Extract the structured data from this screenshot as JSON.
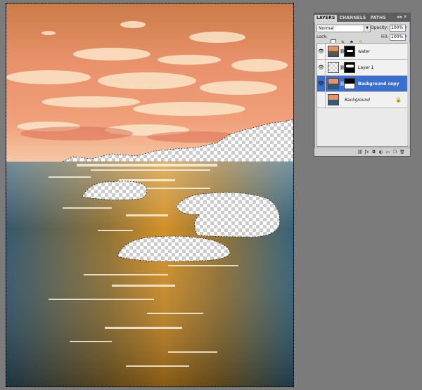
{
  "panel": {
    "tabs": [
      "LAYERS",
      "CHANNELS",
      "PATHS"
    ],
    "active_tab": "LAYERS",
    "tab_controls": "◂◂ ✕",
    "blend_mode": "Normal",
    "opacity_label": "Opacity:",
    "opacity_value": "100%",
    "lock_label": "Lock:",
    "fill_label": "Fill:",
    "fill_value": "100%"
  },
  "layers": [
    {
      "name": "water",
      "visible": true,
      "selected": false
    },
    {
      "name": "Layer 1",
      "visible": true,
      "selected": false
    },
    {
      "name": "Background copy",
      "visible": true,
      "selected": true
    },
    {
      "name": "Background",
      "visible": false,
      "selected": false,
      "locked": true
    }
  ],
  "footer_icons": [
    "link-icon",
    "fx-icon",
    "mask-icon",
    "adjustment-icon",
    "group-icon",
    "new-layer-icon",
    "trash-icon"
  ],
  "colors": {
    "sky": "#e8906a",
    "water_blue": "#2f5b73",
    "water_gold": "#c57d18",
    "selection": "#3a6fd0",
    "workspace": "#7b7b7b"
  }
}
